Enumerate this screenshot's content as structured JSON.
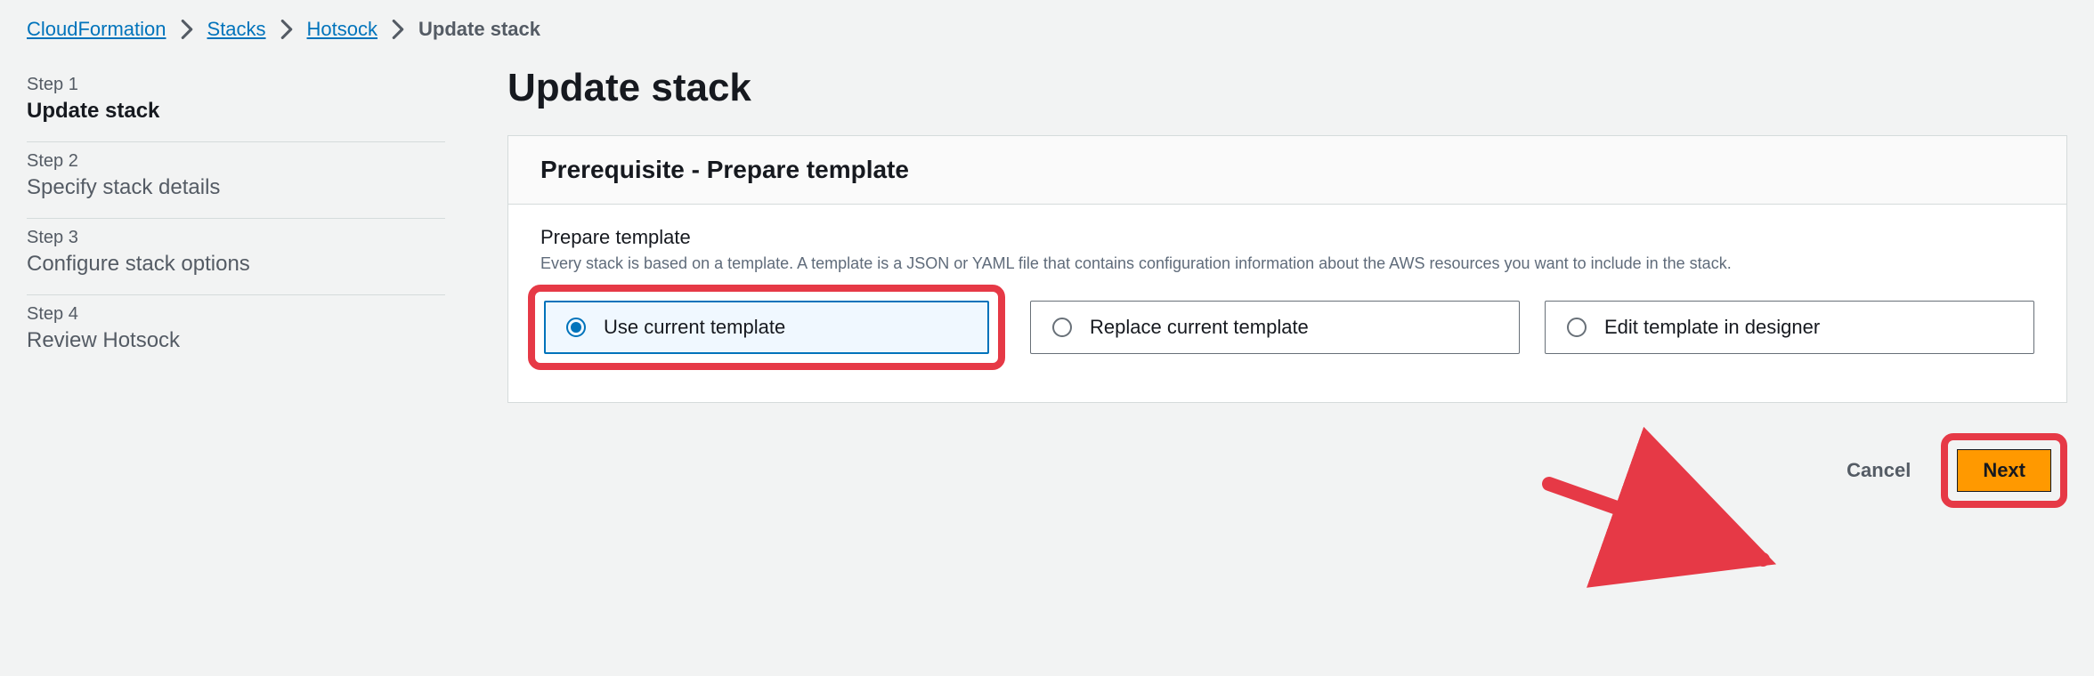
{
  "breadcrumb": {
    "items": [
      {
        "label": "CloudFormation",
        "link": true
      },
      {
        "label": "Stacks",
        "link": true
      },
      {
        "label": "Hotsock",
        "link": true
      }
    ],
    "current": "Update stack"
  },
  "steps": [
    {
      "num": "Step 1",
      "title": "Update stack",
      "active": true
    },
    {
      "num": "Step 2",
      "title": "Specify stack details",
      "active": false
    },
    {
      "num": "Step 3",
      "title": "Configure stack options",
      "active": false
    },
    {
      "num": "Step 4",
      "title": "Review Hotsock",
      "active": false
    }
  ],
  "page": {
    "title": "Update stack"
  },
  "panel": {
    "header": "Prerequisite - Prepare template",
    "field_label": "Prepare template",
    "field_desc": "Every stack is based on a template. A template is a JSON or YAML file that contains configuration information about the AWS resources you want to include in the stack."
  },
  "options": [
    {
      "label": "Use current template",
      "selected": true
    },
    {
      "label": "Replace current template",
      "selected": false
    },
    {
      "label": "Edit template in designer",
      "selected": false
    }
  ],
  "actions": {
    "cancel": "Cancel",
    "next": "Next"
  },
  "annotation": {
    "highlight_color": "#e63946",
    "arrow_color": "#e63946"
  }
}
